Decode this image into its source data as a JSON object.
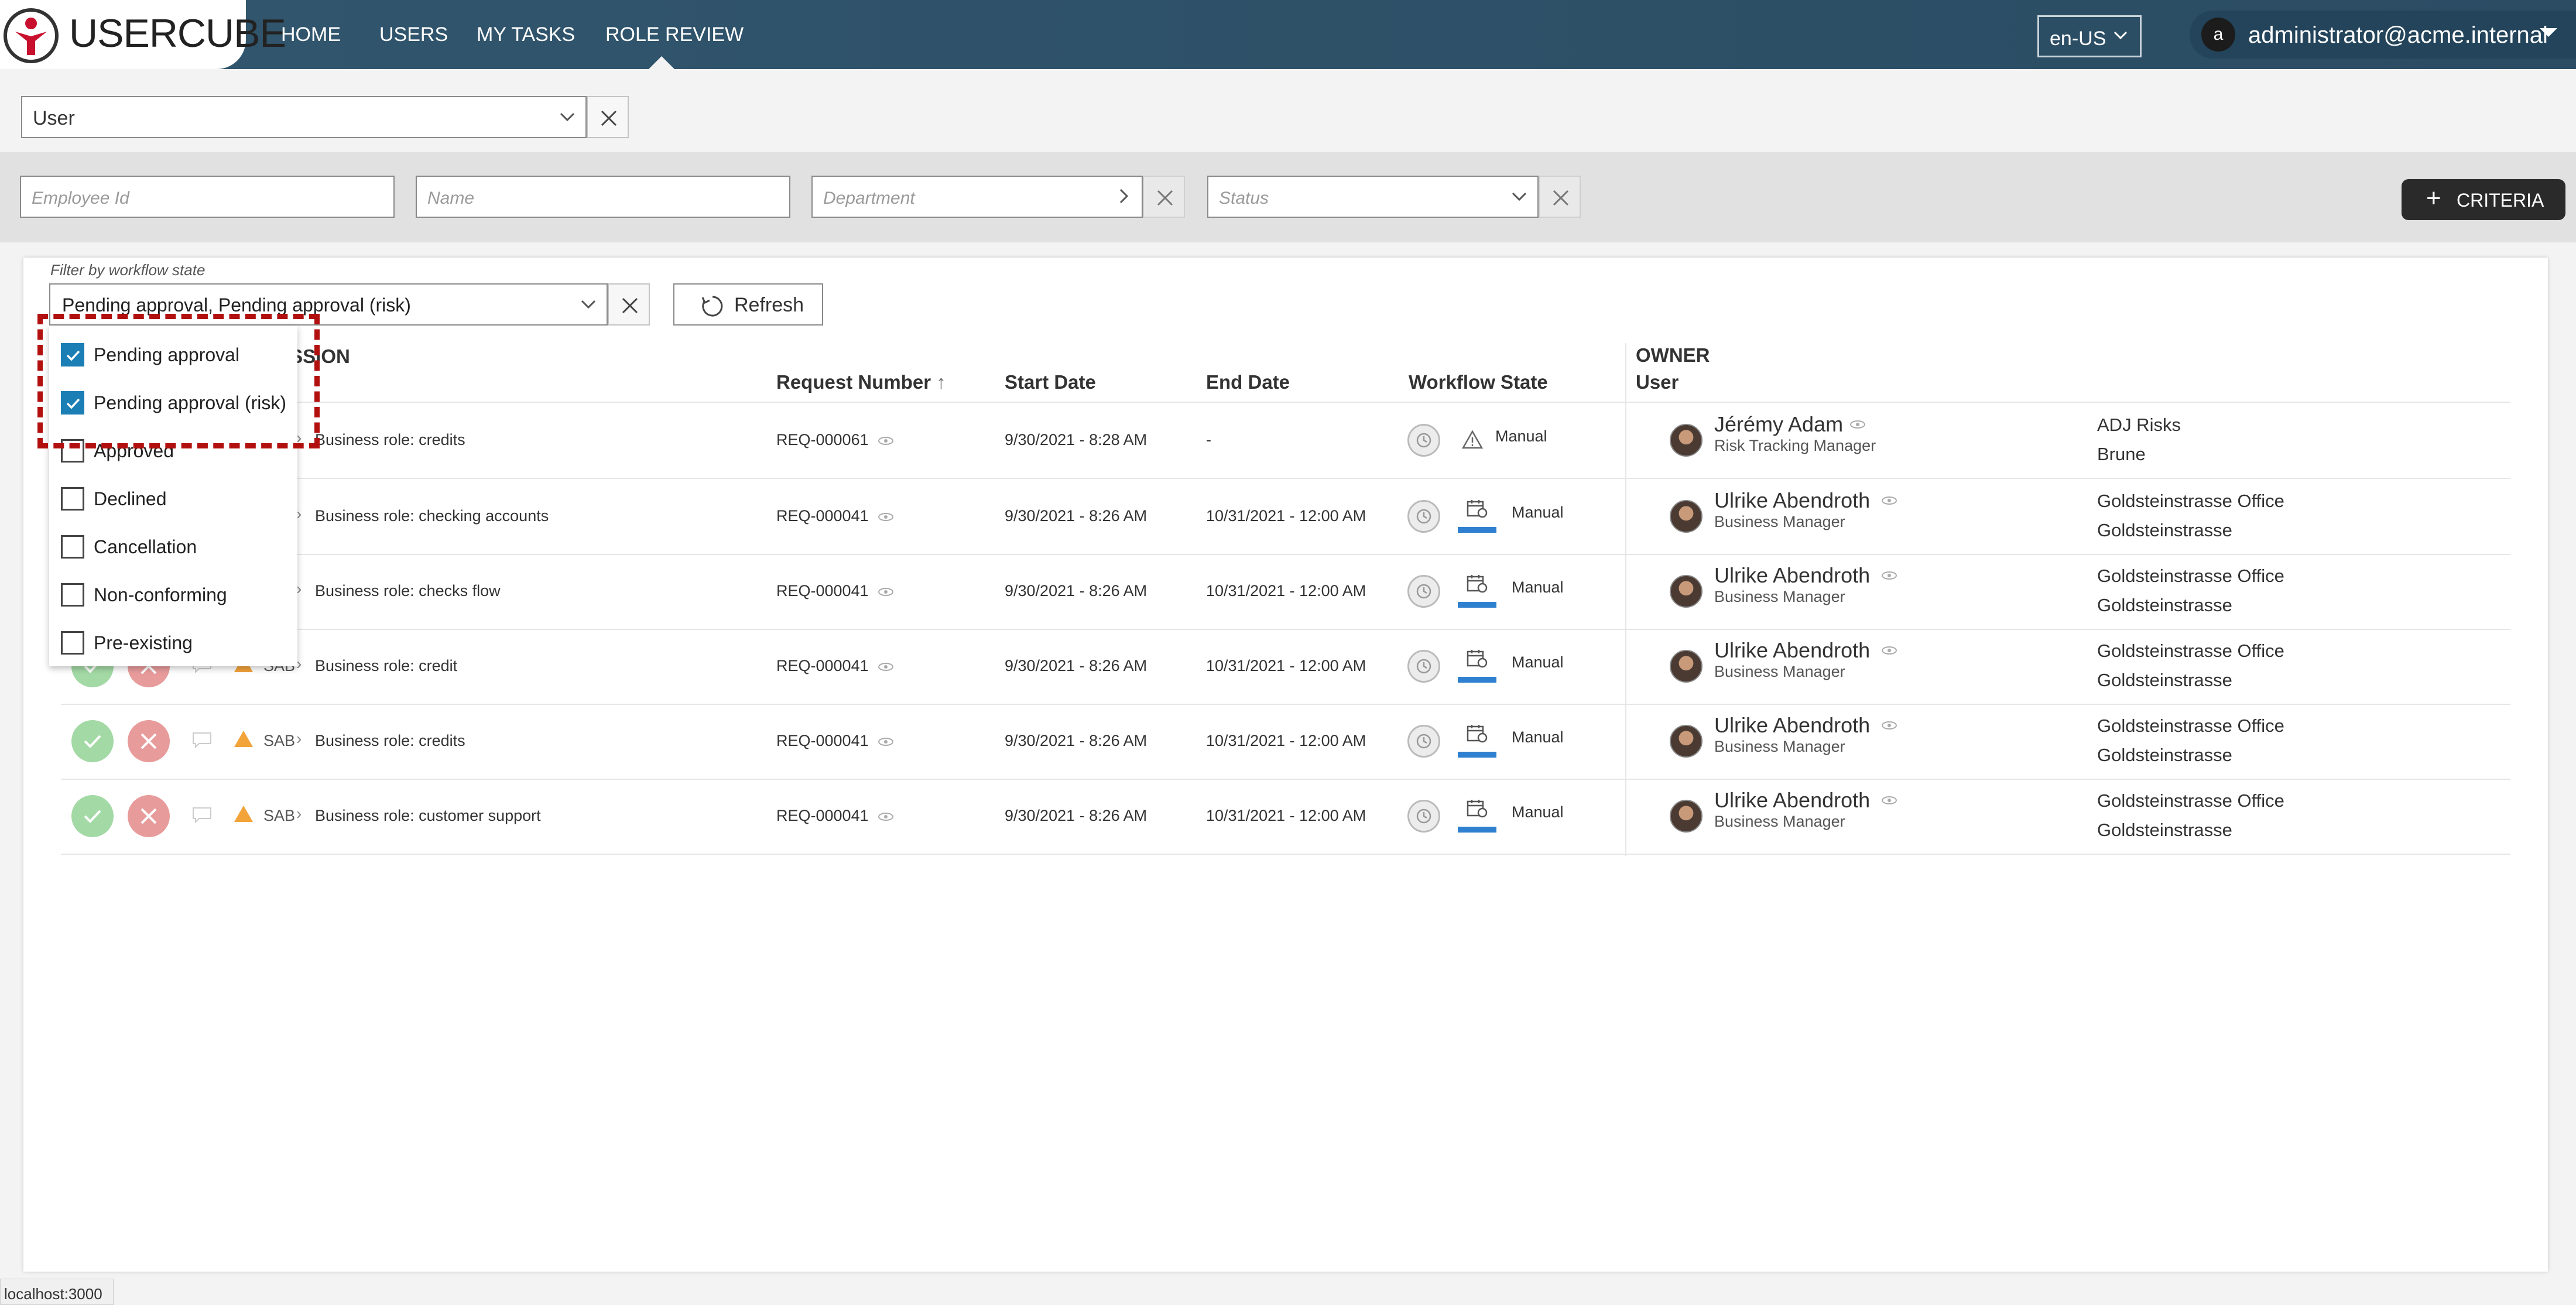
{
  "app": {
    "logo_text": "USERCUBE"
  },
  "nav": {
    "items": [
      {
        "label": "HOME"
      },
      {
        "label": "USERS"
      },
      {
        "label": "MY TASKS"
      },
      {
        "label": "ROLE REVIEW"
      }
    ],
    "active": "ROLE REVIEW"
  },
  "header": {
    "language": "en-US",
    "avatar_letter": "a",
    "user_email": "administrator@acme.internal"
  },
  "entity": {
    "value": "User"
  },
  "filters": {
    "employee_id_placeholder": "Employee Id",
    "name_placeholder": "Name",
    "department_placeholder": "Department",
    "status_placeholder": "Status",
    "criteria_label": "CRITERIA"
  },
  "workflow_filter": {
    "label": "Filter by workflow state",
    "value": "Pending approval, Pending approval (risk)",
    "refresh_label": "Refresh",
    "options": [
      {
        "label": "Pending approval",
        "checked": true
      },
      {
        "label": "Pending approval (risk)",
        "checked": true
      },
      {
        "label": "Approved",
        "checked": false
      },
      {
        "label": "Declined",
        "checked": false
      },
      {
        "label": "Cancellation",
        "checked": false
      },
      {
        "label": "Non-conforming",
        "checked": false
      },
      {
        "label": "Pre-existing",
        "checked": false
      }
    ]
  },
  "table": {
    "headers": {
      "permission": "ISSION",
      "request_number": "Request Number",
      "start_date": "Start Date",
      "end_date": "End Date",
      "workflow_state": "Workflow State",
      "owner": "OWNER",
      "owner_sub": "User"
    },
    "rows": [
      {
        "system": "",
        "role": "Business role: credits",
        "request": "REQ-000061",
        "start": "9/30/2021  - 8:28 AM",
        "end": "-",
        "state": "Manual",
        "owner_name": "Jérémy Adam",
        "owner_role": "Risk Tracking Manager",
        "org1": "ADJ Risks",
        "org2": "Brune"
      },
      {
        "system": "",
        "role": "Business role: checking accounts",
        "request": "REQ-000041",
        "start": "9/30/2021  - 8:26 AM",
        "end": "10/31/2021  - 12:00 AM",
        "state": "Manual",
        "owner_name": "Ulrike Abendroth",
        "owner_role": "Business Manager",
        "org1": "Goldsteinstrasse Office",
        "org2": "Goldsteinstrasse"
      },
      {
        "system": "",
        "role": "Business role: checks flow",
        "request": "REQ-000041",
        "start": "9/30/2021  - 8:26 AM",
        "end": "10/31/2021  - 12:00 AM",
        "state": "Manual",
        "owner_name": "Ulrike Abendroth",
        "owner_role": "Business Manager",
        "org1": "Goldsteinstrasse Office",
        "org2": "Goldsteinstrasse"
      },
      {
        "system": "SAB",
        "role": "Business role: credit",
        "request": "REQ-000041",
        "start": "9/30/2021  - 8:26 AM",
        "end": "10/31/2021  - 12:00 AM",
        "state": "Manual",
        "owner_name": "Ulrike Abendroth",
        "owner_role": "Business Manager",
        "org1": "Goldsteinstrasse Office",
        "org2": "Goldsteinstrasse"
      },
      {
        "system": "SAB",
        "role": "Business role: credits",
        "request": "REQ-000041",
        "start": "9/30/2021  - 8:26 AM",
        "end": "10/31/2021  - 12:00 AM",
        "state": "Manual",
        "owner_name": "Ulrike Abendroth",
        "owner_role": "Business Manager",
        "org1": "Goldsteinstrasse Office",
        "org2": "Goldsteinstrasse"
      },
      {
        "system": "SAB",
        "role": "Business role: customer support",
        "request": "REQ-000041",
        "start": "9/30/2021  - 8:26 AM",
        "end": "10/31/2021  - 12:00 AM",
        "state": "Manual",
        "owner_name": "Ulrike Abendroth",
        "owner_role": "Business Manager",
        "org1": "Goldsteinstrasse Office",
        "org2": "Goldsteinstrasse"
      }
    ]
  },
  "statusbar": {
    "url": "localhost:3000"
  },
  "colors": {
    "topbar": "#2e5168",
    "accent": "#1b7fb6",
    "highlight": "#b20f0f",
    "approve": "#a3d9a5",
    "decline": "#e89b9b"
  }
}
